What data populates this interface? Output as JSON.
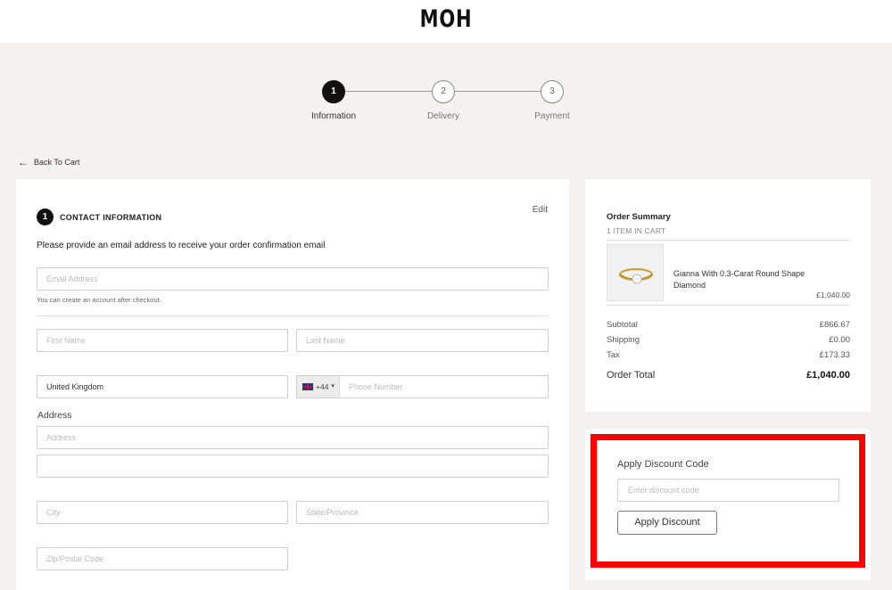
{
  "brand": {
    "logo": "MOH"
  },
  "steps": [
    {
      "number": "1",
      "label": "Information",
      "active": true
    },
    {
      "number": "2",
      "label": "Delivery",
      "active": false
    },
    {
      "number": "3",
      "label": "Payment",
      "active": false
    }
  ],
  "nav": {
    "back_label": "Back To Cart"
  },
  "contact": {
    "step_number": "1",
    "title": "CONTACT INFORMATION",
    "edit_label": "Edit",
    "intro": "Please provide an email address to receive your order confirmation email",
    "email_placeholder": "Email Address",
    "email_hint": "You can create an account after checkout.",
    "first_name_placeholder": "First Name",
    "last_name_placeholder": "Last Name",
    "country_value": "United Kingdom",
    "phone_code": "+44",
    "phone_code_caret": "▾",
    "phone_placeholder": "Phone Number",
    "address_label": "Address",
    "address_placeholder": "Address",
    "address2_placeholder": "",
    "city_placeholder": "City",
    "state_placeholder": "State/Province",
    "zip_placeholder": "Zip/Postal Code"
  },
  "summary": {
    "title": "Order Summary",
    "count": "1 ITEM IN CART",
    "product_name": "Gianna With 0.3-Carat Round Shape Diamond",
    "product_price": "£1,040.00",
    "rows": [
      {
        "label": "Subtotal",
        "value": "£866.67"
      },
      {
        "label": "Shipping",
        "value": "£0.00"
      },
      {
        "label": "Tax",
        "value": "£173.33"
      }
    ],
    "total_label": "Order Total",
    "total_value": "£1,040.00"
  },
  "discount": {
    "title": "Apply Discount Code",
    "placeholder": "Enter discount code",
    "button_label": "Apply Discount"
  },
  "colors": {
    "highlight": "#ff0000",
    "accent": "#111111"
  },
  "icons": {
    "back": "arrow-left-icon",
    "flag": "uk-flag-icon",
    "ring": "ring-product-image"
  }
}
